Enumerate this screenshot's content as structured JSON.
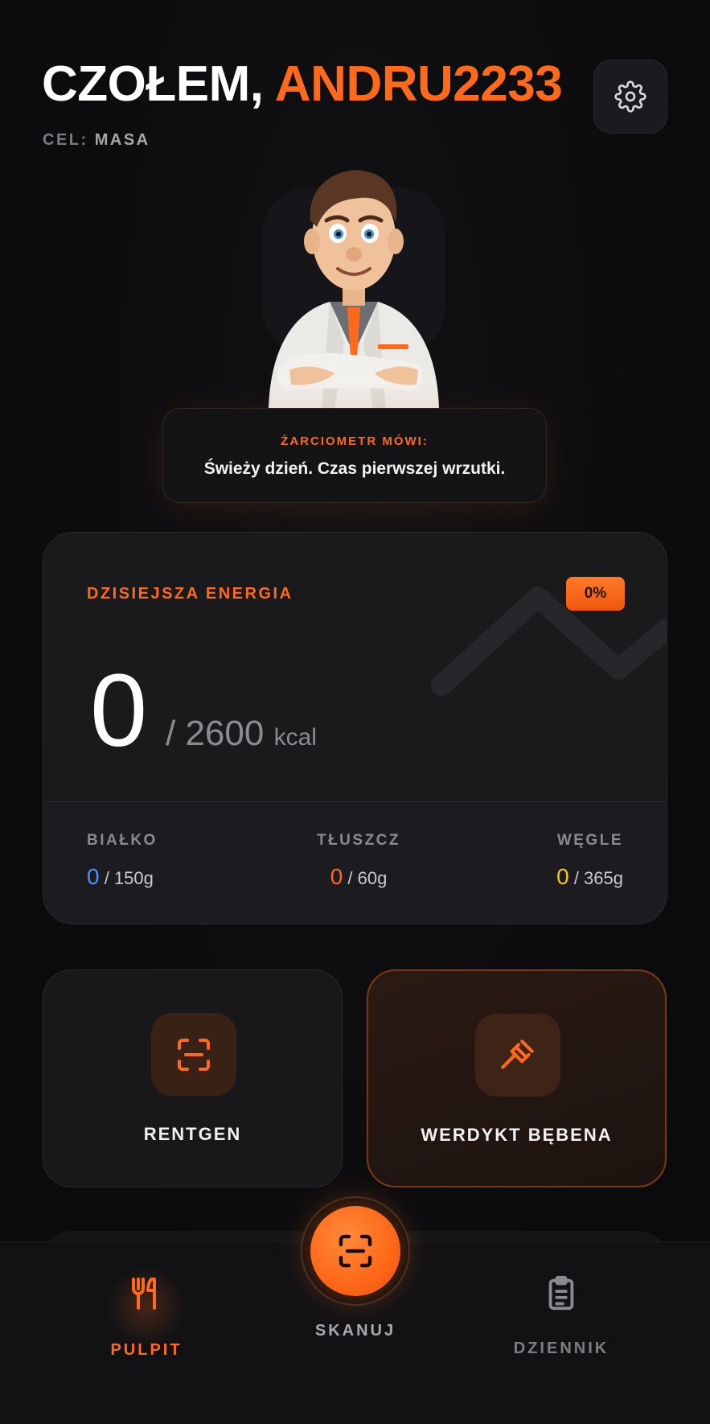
{
  "header": {
    "greeting_prefix": "CZOŁEM, ",
    "username": "ANDRU2233",
    "goal_label": "CEL: ",
    "goal_value": "MASA"
  },
  "mascot": {
    "speaker_label": "ŻARCIOMETR MÓWI:",
    "message": "Świeży dzień. Czas pierwszej wrzutki."
  },
  "energy": {
    "title": "DZISIEJSZA ENERGIA",
    "percent_label": "0%",
    "percent": 0,
    "current": "0",
    "goal": "/ 2600",
    "unit": "kcal"
  },
  "macros": {
    "protein": {
      "label": "BIAŁKO",
      "value": "0",
      "goal": " / 150g",
      "color": "#4a90ff"
    },
    "fat": {
      "label": "TŁUSZCZ",
      "value": "0",
      "goal": " / 60g",
      "color": "#ff6a1a"
    },
    "carbs": {
      "label": "WĘGLE",
      "value": "0",
      "goal": " / 365g",
      "color": "#f5c518"
    }
  },
  "actions": {
    "xray": {
      "label": "RENTGEN",
      "icon": "scan-frame-icon"
    },
    "verdict": {
      "label": "WERDYKT BĘBENA",
      "icon": "gavel-icon"
    }
  },
  "nav": {
    "pulpit": {
      "label": "PULPIT",
      "icon": "utensils-icon"
    },
    "scan": {
      "label": "SKANUJ",
      "icon": "scan-frame-icon"
    },
    "dziennik": {
      "label": "DZIENNIK",
      "icon": "clipboard-icon"
    }
  },
  "colors": {
    "accent": "#ff6a1a",
    "background": "#0b0b0d",
    "card": "#1c1c20"
  }
}
